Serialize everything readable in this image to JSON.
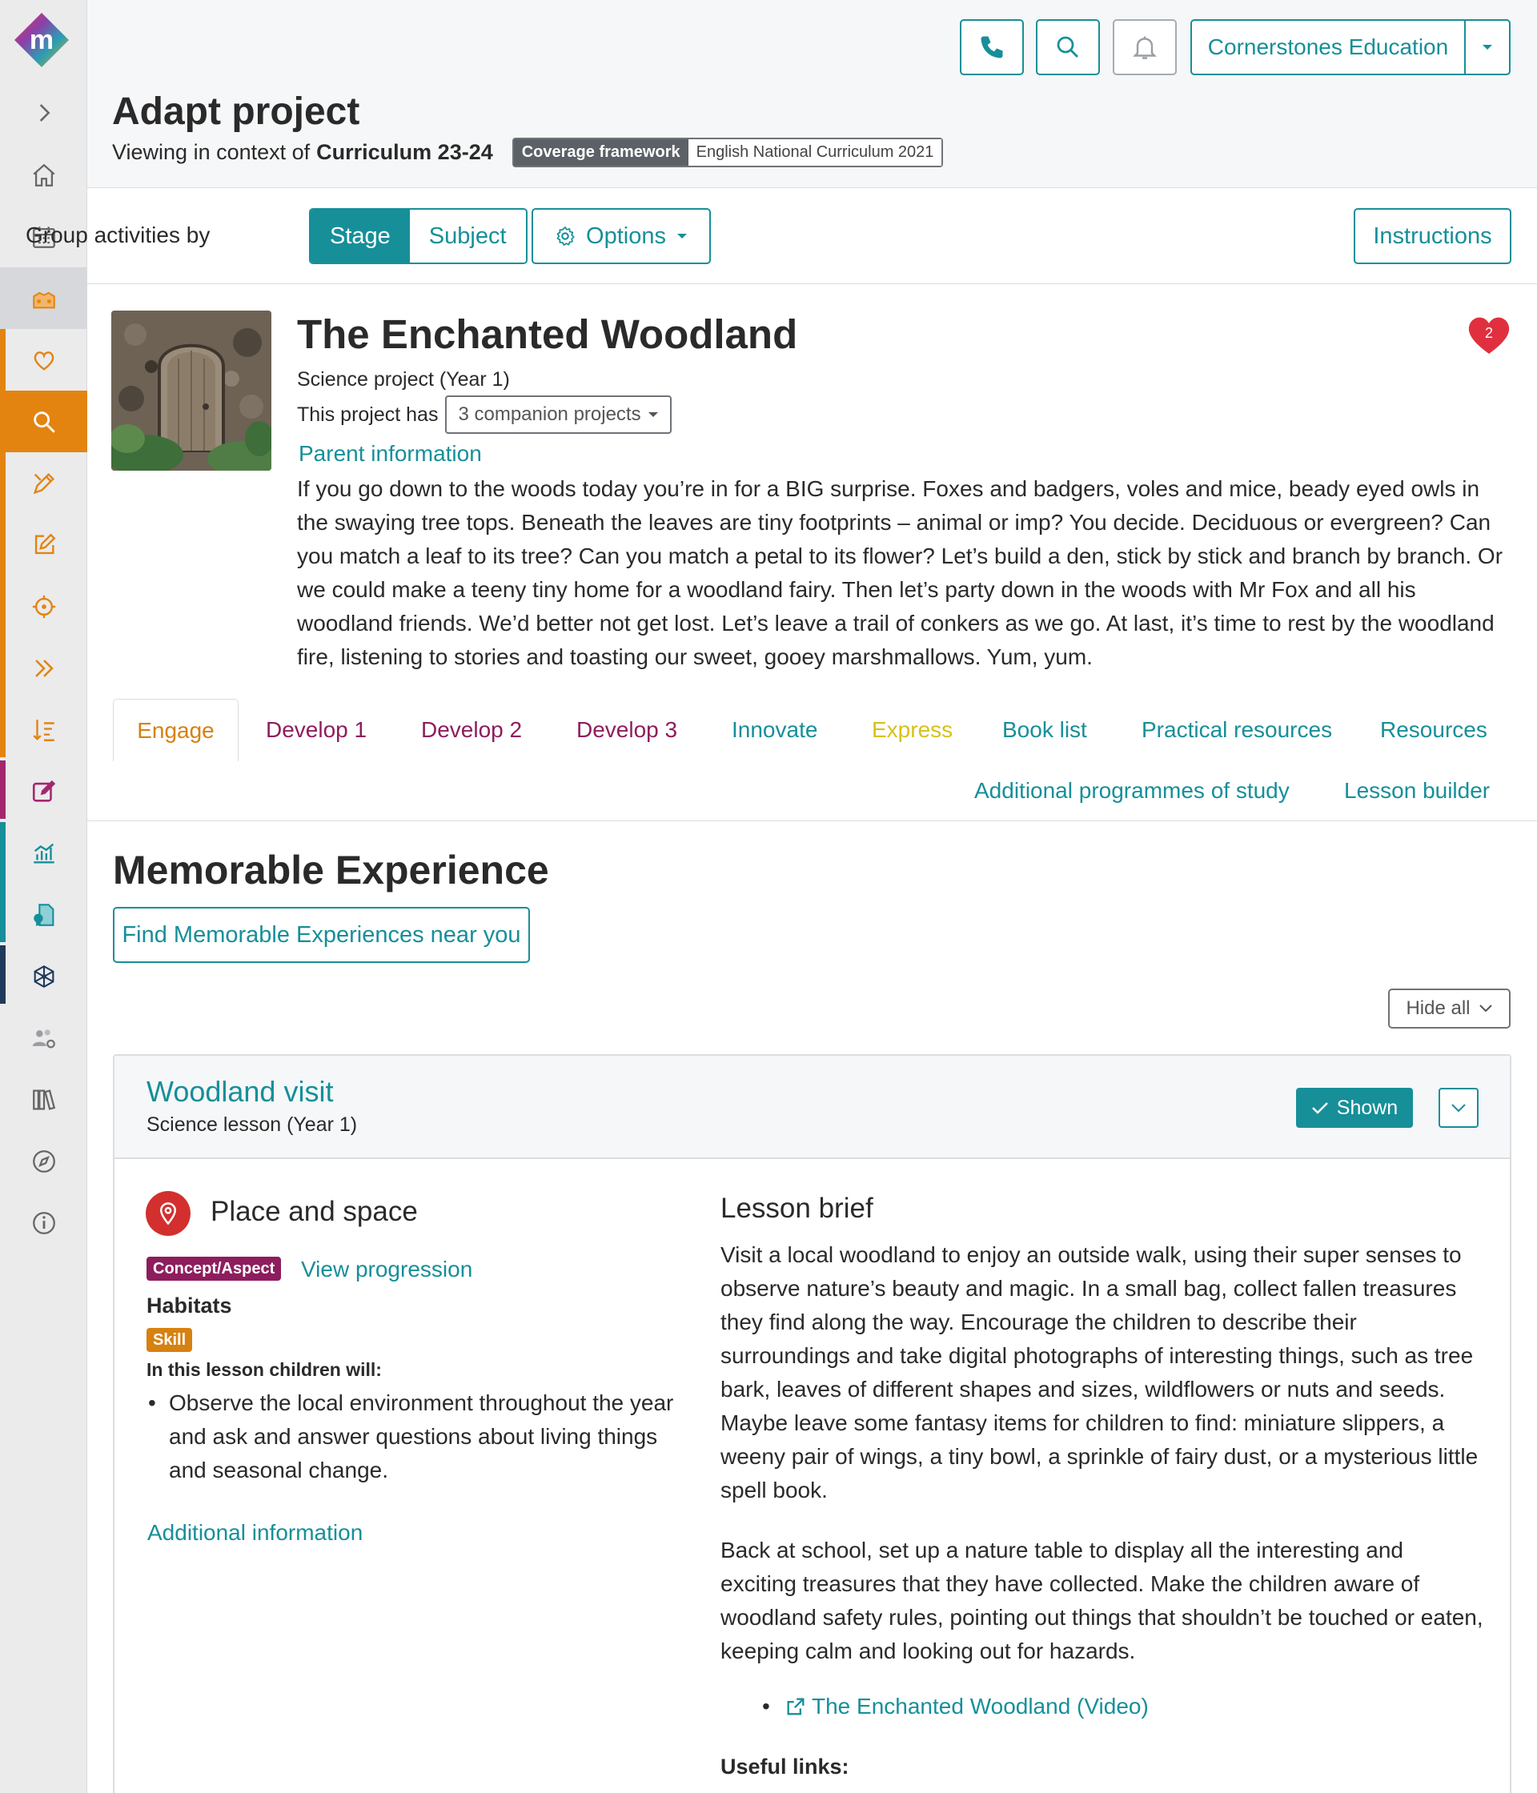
{
  "header": {
    "title": "Adapt project",
    "context_prefix": "Viewing in context of",
    "context_curriculum": "Curriculum 23-24",
    "coverage_label": "Coverage framework",
    "coverage_value": "English National Curriculum 2021",
    "school_name": "Cornerstones Education",
    "icons": [
      "phone-icon",
      "search-icon",
      "bell-icon",
      "chevron-down-icon"
    ]
  },
  "toolbar": {
    "group_by_label": "Group activities by",
    "stage_label": "Stage",
    "subject_label": "Subject",
    "options_label": "Options",
    "instructions_label": "Instructions"
  },
  "project": {
    "title": "The Enchanted Woodland",
    "subtitle": "Science project (Year 1)",
    "has_label": "This project has",
    "companion_label": "3 companion projects",
    "parent_link": "Parent information",
    "favourite_count": "2",
    "description": "If you go down to the woods today you’re in for a BIG surprise. Foxes and badgers, voles and mice, beady eyed owls in the swaying tree tops. Beneath the leaves are tiny footprints – animal or imp? You decide. Deciduous or evergreen? Can you match a leaf to its tree? Can you match a petal to its flower? Let’s build a den, stick by stick and branch by branch. Or we could make a teeny tiny home for a woodland fairy. Then let’s party down in the woods with Mr Fox and all his woodland friends. We’d better not get lost. Let’s leave a trail of conkers as we go. At last, it’s time to rest by the woodland fire, listening to stories and toasting our sweet, gooey marshmallows. Yum, yum."
  },
  "tabs": [
    {
      "label": "Engage",
      "color": "#d68110",
      "active": true
    },
    {
      "label": "Develop 1",
      "color": "#8e1d5e"
    },
    {
      "label": "Develop 2",
      "color": "#8e1d5e"
    },
    {
      "label": "Develop 3",
      "color": "#8e1d5e"
    },
    {
      "label": "Innovate",
      "color": "#168f99"
    },
    {
      "label": "Express",
      "color": "#d7c11a"
    },
    {
      "label": "Book list",
      "color": "#168f99"
    },
    {
      "label": "Practical resources",
      "color": "#168f99"
    },
    {
      "label": "Resources",
      "color": "#168f99"
    },
    {
      "label": "Additional programmes of study",
      "color": "#168f99"
    },
    {
      "label": "Lesson builder",
      "color": "#168f99"
    }
  ],
  "section": {
    "title": "Memorable Experience",
    "find_button": "Find Memorable Experiences near you",
    "hide_all": "Hide all"
  },
  "lesson": {
    "title": "Woodland visit",
    "subtitle": "Science lesson (Year 1)",
    "shown_label": "Shown",
    "place_title": "Place and space",
    "concept_badge": "Concept/Aspect",
    "view_progression": "View progression",
    "concept": "Habitats",
    "skill_badge": "Skill",
    "will_label": "In this lesson children will:",
    "bullets": [
      "Observe the local environment throughout the year and ask and answer questions about living things and seasonal change."
    ],
    "additional_info": "Additional information",
    "brief_title": "Lesson brief",
    "brief_p1": "Visit a local woodland to enjoy an outside walk, using their super senses to observe nature’s beauty and magic. In a small bag, collect fallen treasures they find along the way. Encourage the children to describe their surroundings and take digital photographs of interesting things, such as tree bark, leaves of different shapes and sizes, wildflowers or nuts and seeds. Maybe leave some fantasy items for children to find: miniature slippers, a weeny pair of wings, a tiny bowl, a sprinkle of fairy dust, or a mysterious little spell book.",
    "brief_p2": "Back at school, set up a nature table to display all the interesting and exciting treasures that they have collected. Make the children aware of woodland safety rules, pointing out things that shouldn’t be touched or eaten, keeping calm and looking out for hazards.",
    "video_link": "The Enchanted Woodland (Video)",
    "useful_links": "Useful links:"
  },
  "colors": {
    "accent": "#168f99",
    "engage": "#d68110",
    "develop": "#8e1d5e",
    "express": "#d7c11a",
    "pin": "#d32f2f",
    "heart": "#e0303f"
  }
}
